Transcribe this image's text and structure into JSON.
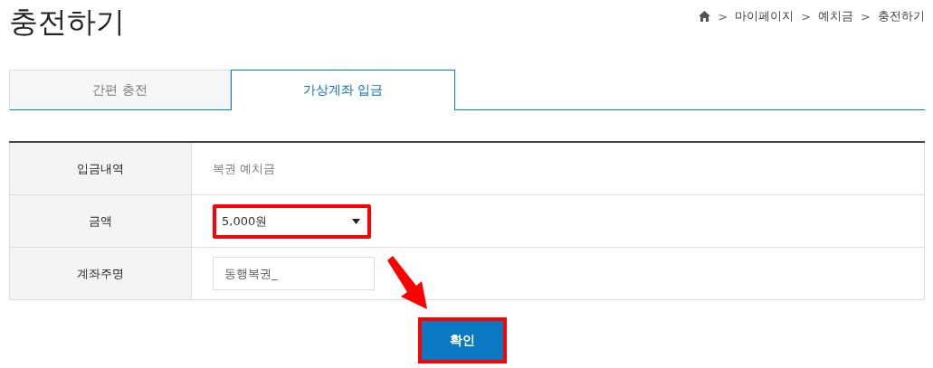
{
  "page_title": "충전하기",
  "breadcrumb": [
    "마이페이지",
    "예치금",
    "충전하기"
  ],
  "breadcrumb_separator": ">",
  "tabs": [
    {
      "label": "간편 충전",
      "selected": false
    },
    {
      "label": "가상계좌 입금",
      "selected": true
    }
  ],
  "form_rows": [
    {
      "kind": "text",
      "label": "입금내역",
      "value": "복권 예치금"
    },
    {
      "kind": "select",
      "label": "금액",
      "value": "5,000원",
      "highlighted": true
    },
    {
      "kind": "input",
      "label": "계좌주명",
      "value": "동행복권_"
    }
  ],
  "confirm_button": {
    "label": "확인",
    "highlighted": true
  }
}
